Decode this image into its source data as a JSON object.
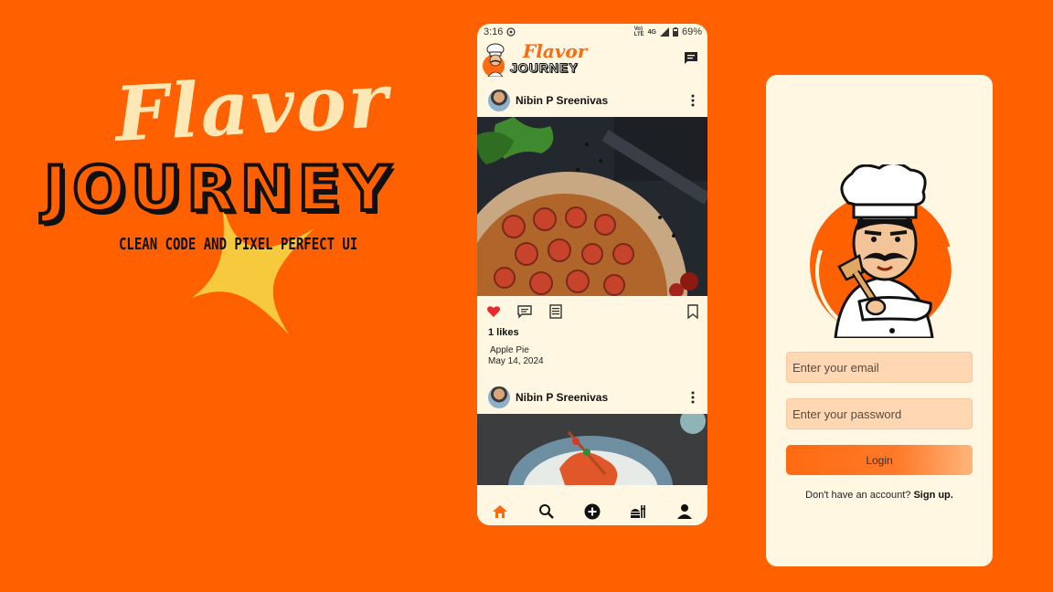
{
  "colors": {
    "background": "#ff6000",
    "accent": "#ff6a10",
    "phone_bg": "#fff7e2",
    "input_bg": "#ffd7b3",
    "like_red": "#e8282d"
  },
  "promo": {
    "title_line1": "Flavor",
    "title_line2": "JOURNEY",
    "tagline": "CLEAN CODE AND PIXEL PERFECT UI"
  },
  "feed_phone": {
    "status": {
      "time": "3:16",
      "network_top": "Vo)",
      "network_bottom": "LTE",
      "network_gen": "4G",
      "battery": "69%"
    },
    "header": {
      "logo_line1": "Flavor",
      "logo_line2": "JOURNEY",
      "chat_icon": "chat-icon"
    },
    "posts": [
      {
        "user": "Nibin P Sreenivas",
        "likes": "1 likes",
        "caption": "Apple Pie",
        "date": "May 14, 2024",
        "liked": true
      },
      {
        "user": "Nibin P Sreenivas"
      }
    ],
    "bottom_nav": [
      "home-icon",
      "search-icon",
      "add-icon",
      "recipes-icon",
      "profile-icon"
    ]
  },
  "login_phone": {
    "email_placeholder": "Enter your email",
    "password_placeholder": "Enter your password",
    "login_label": "Login",
    "signup_prompt": "Don't have an account?",
    "signup_link": "Sign up."
  }
}
